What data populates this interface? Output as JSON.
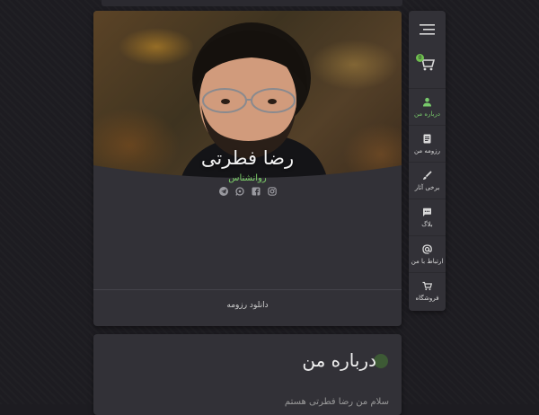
{
  "profile": {
    "name": "رضا فطرتی",
    "role": "روانشناس",
    "download_label": "دانلود رزومه",
    "socials": [
      "instagram-icon",
      "facebook-icon",
      "whatsapp-icon",
      "telegram-icon"
    ]
  },
  "about": {
    "title": "درباره من",
    "first_line": "سلام من رضا فطرتی هستم"
  },
  "nav": {
    "cart_count": "0",
    "items": [
      {
        "label": "درباره من",
        "icon": "person-icon",
        "active": true
      },
      {
        "label": "رزومه من",
        "icon": "document-icon",
        "active": false
      },
      {
        "label": "برخی آثار",
        "icon": "brush-icon",
        "active": false
      },
      {
        "label": "بلاگ",
        "icon": "chat-icon",
        "active": false
      },
      {
        "label": "ارتباط با من",
        "icon": "at-icon",
        "active": false
      },
      {
        "label": "فروشگاه",
        "icon": "cart-icon",
        "active": false
      }
    ]
  },
  "colors": {
    "accent": "#7ed36a",
    "card": "#323137",
    "background": "#1d1c21"
  }
}
